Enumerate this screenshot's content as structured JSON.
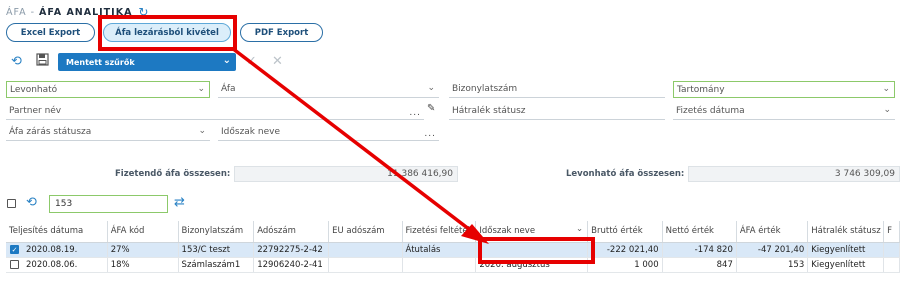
{
  "header": {
    "prefix": "ÁFA",
    "separator": "-",
    "title": "ÁFA ANALITIKA"
  },
  "toolbar": {
    "excel_export": "Excel Export",
    "afa_lezaras_kivetel": "Áfa lezárásból kivétel",
    "pdf_export": "PDF Export"
  },
  "filters": {
    "saved_filters": "Mentett szűrők",
    "levonhato": "Levonható",
    "afa": "Áfa",
    "bizonylatszam": "Bizonylatszám",
    "tartomany": "Tartomány",
    "partner_nev": "Partner név",
    "hatralek_status": "Hátralék státusz",
    "fizetes_datuma": "Fizetés dátuma",
    "afa_zaras_status": "Áfa zárás státusza",
    "idoszak_neve": "Időszak neve",
    "dots": "..."
  },
  "summary": {
    "fizetendo_label": "Fizetendő áfa összesen:",
    "fizetendo_value": "11 386 416,90",
    "levonhato_label": "Levonható áfa összesen:",
    "levonhato_value": "3 746 309,09"
  },
  "search": {
    "value": "153"
  },
  "table": {
    "columns": [
      "Teljesítés dátuma",
      "ÁFA kód",
      "Bizonylatszám",
      "Adószám",
      "EU adószám",
      "Fizetési feltétel",
      "Időszak neve",
      "Bruttó érték",
      "Nettó érték",
      "ÁFA érték",
      "Hátralék státusz",
      "F"
    ],
    "rows": [
      {
        "selected": true,
        "cells": [
          "2020.08.19.",
          "27%",
          "153/C teszt",
          "22792275-2-42",
          "",
          "Átutalás",
          "",
          "-222 021,40",
          "-174 820",
          "-47 201,40",
          "Kiegyenlített",
          ""
        ]
      },
      {
        "selected": false,
        "cells": [
          "2020.08.06.",
          "18%",
          "Számlaszám1",
          "12906240-2-41",
          "",
          "",
          "2020. augusztus",
          "1 000",
          "847",
          "153",
          "Kiegyenlített",
          ""
        ]
      }
    ]
  },
  "colors": {
    "accent": "#1d79c2",
    "highlight": "#e60000",
    "selected_row": "#d9e8f7",
    "green_border": "#8cc96a"
  },
  "icons": [
    "refresh-icon",
    "reset-filter-icon",
    "save-icon",
    "check-icon",
    "clear-icon",
    "edit-icon",
    "swap-icon",
    "sort-icon"
  ]
}
